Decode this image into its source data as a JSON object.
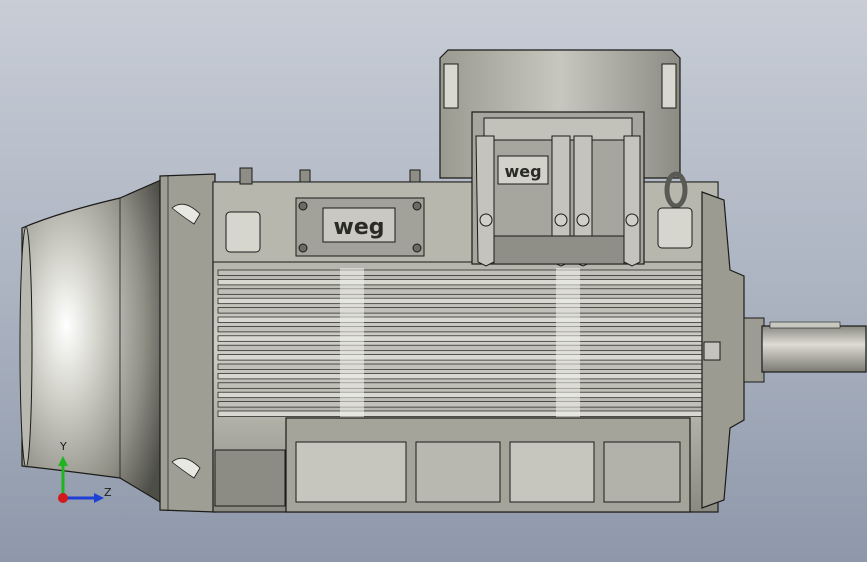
{
  "model": {
    "brand_text_nameplate": "weg",
    "brand_text_terminal_box": "weg"
  },
  "triad": {
    "y_label": "Y",
    "z_label": "Z",
    "colors": {
      "y": "#1fb51f",
      "z": "#1e40d6",
      "x": "#d11a1a"
    }
  },
  "colors": {
    "background_top": "#c8cdd6",
    "background_bottom": "#8e98aa",
    "metal_light": "#d4d4cd",
    "metal_mid": "#a9a99f",
    "metal_dark": "#5c5c55",
    "outline": "#1b1b18"
  }
}
